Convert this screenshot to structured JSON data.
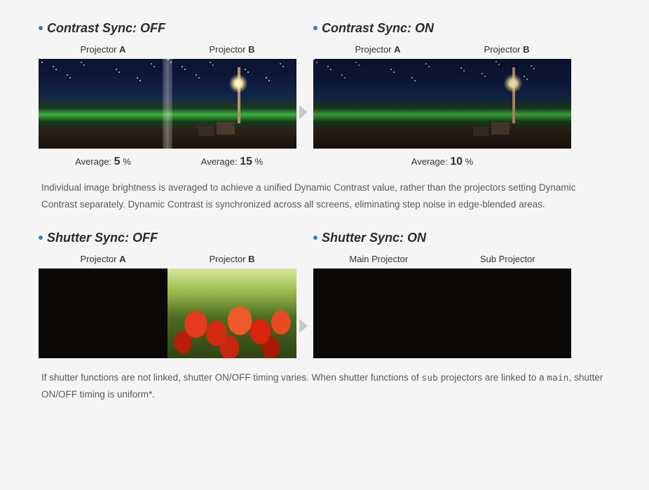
{
  "contrast": {
    "off": {
      "heading": "Contrast Sync: OFF",
      "projA_prefix": "Projector ",
      "projA_bold": "A",
      "projB_prefix": "Projector ",
      "projB_bold": "B",
      "avgA_prefix": "Average: ",
      "avgA_value": "5",
      "avgA_unit": " %",
      "avgB_prefix": "Average: ",
      "avgB_value": "15",
      "avgB_unit": " %"
    },
    "on": {
      "heading": "Contrast Sync: ON",
      "projA_prefix": "Projector ",
      "projA_bold": "A",
      "projB_prefix": "Projector ",
      "projB_bold": "B",
      "avg_prefix": "Average: ",
      "avg_value": "10",
      "avg_unit": " %"
    },
    "description_1": "Individual image brightness is averaged to achieve a unified Dynamic Contrast value, rather than the projectors setting Dynamic Contrast separately. Dynamic Contrast is synchronized across all screens, eliminating step noise in edge-blended areas."
  },
  "shutter": {
    "off": {
      "heading": "Shutter Sync: OFF",
      "projA_prefix": "Projector ",
      "projA_bold": "A",
      "projB_prefix": "Projector ",
      "projB_bold": "B"
    },
    "on": {
      "heading": "Shutter Sync: ON",
      "main_label": "Main Projector",
      "sub_label": "Sub Projector"
    },
    "desc_part1": "If shutter functions are not linked, shutter ON/OFF timing varies. When shutter functions of ",
    "desc_sub": "sub",
    "desc_part2": " projectors are linked to a ",
    "desc_main": "main",
    "desc_part3": ", shutter ON/OFF timing is uniform*."
  }
}
